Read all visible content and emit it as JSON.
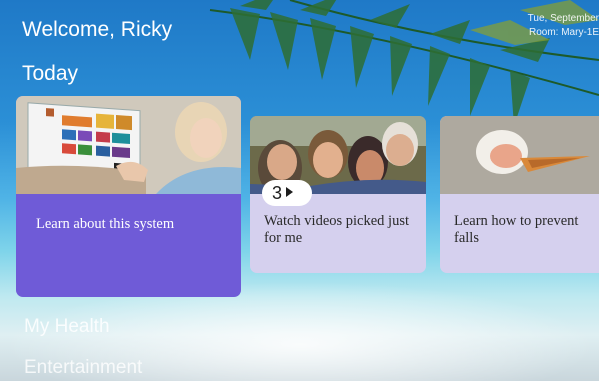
{
  "header": {
    "welcome": "Welcome, Ricky",
    "date": "Tue, September",
    "room": "Room: Mary-1E"
  },
  "today": {
    "title": "Today",
    "cards": [
      {
        "label": "Learn about this system"
      },
      {
        "label": "Watch videos picked just for me",
        "badge_count": "3"
      },
      {
        "label": "Learn how to prevent falls"
      }
    ]
  },
  "sections": {
    "my_health": "My Health",
    "entertainment": "Entertainment"
  },
  "icons": {
    "badge_icon": "play-icon"
  },
  "colors": {
    "accent": "#6f5bd7",
    "card_light": "#d5d0ee"
  }
}
